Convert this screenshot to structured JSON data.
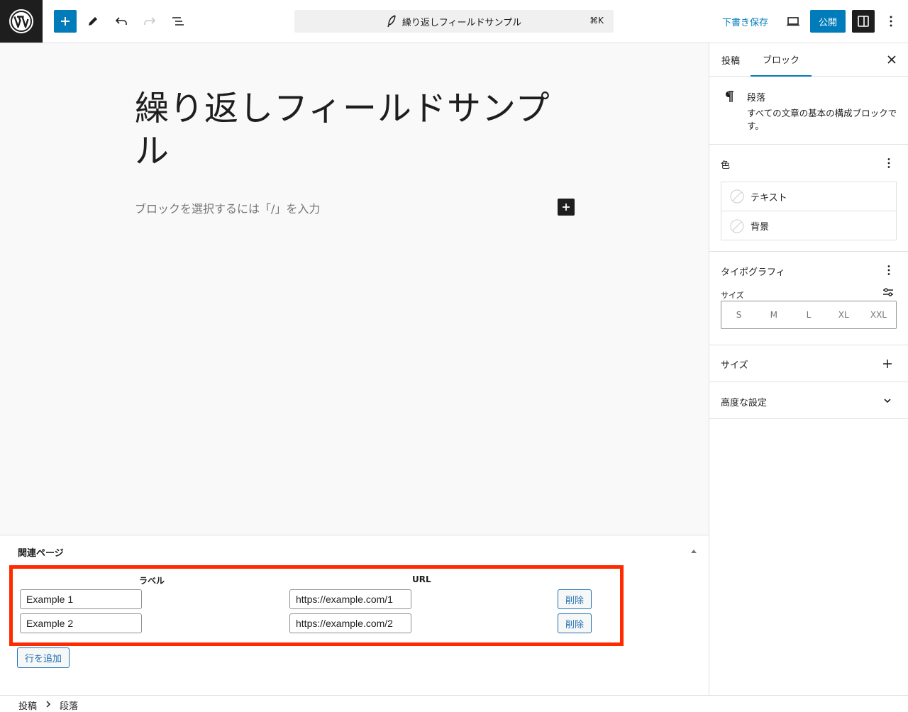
{
  "header": {
    "document_title": "繰り返しフィールドサンプル",
    "shortcut": "⌘K",
    "save_draft": "下書き保存",
    "publish": "公開"
  },
  "editor": {
    "title": "繰り返しフィールドサンプル",
    "placeholder": "ブロックを選択するには「/」を入力"
  },
  "metabox": {
    "title": "関連ページ",
    "columns": {
      "label": "ラベル",
      "url": "URL"
    },
    "rows": [
      {
        "label": "Example 1",
        "url": "https://example.com/1",
        "delete": "削除"
      },
      {
        "label": "Example 2",
        "url": "https://example.com/2",
        "delete": "削除"
      }
    ],
    "add_row": "行を追加"
  },
  "breadcrumb": {
    "items": [
      "投稿",
      "段落"
    ]
  },
  "sidebar": {
    "tabs": [
      "投稿",
      "ブロック"
    ],
    "active_tab": "ブロック",
    "block": {
      "name": "段落",
      "description": "すべての文章の基本の構成ブロックです。"
    },
    "color": {
      "label": "色",
      "items": [
        "テキスト",
        "背景"
      ]
    },
    "typography": {
      "label": "タイポグラフィ",
      "size_label": "サイズ",
      "sizes": [
        "S",
        "M",
        "L",
        "XL",
        "XXL"
      ]
    },
    "dimensions": {
      "label": "サイズ"
    },
    "advanced": {
      "label": "高度な設定"
    }
  },
  "colors": {
    "accent": "#007cba",
    "dark": "#1e1e1e",
    "highlight": "#ff2a00"
  }
}
